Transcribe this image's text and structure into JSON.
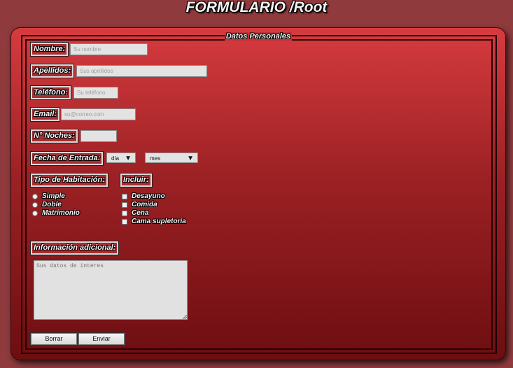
{
  "page": {
    "title": "FORMULARIO /Root"
  },
  "fieldset": {
    "legend": "Datos Personales"
  },
  "fields": {
    "nombre": {
      "label": "Nombre:",
      "placeholder": "Su nombre"
    },
    "apellidos": {
      "label": "Apellidos:",
      "placeholder": "Sus apellidos"
    },
    "telefono": {
      "label": "Teléfono:",
      "placeholder": "Su teléfono"
    },
    "email": {
      "label": "Email:",
      "placeholder": "su@correo.com"
    },
    "noches": {
      "label": "N° Noches:",
      "placeholder": ""
    },
    "fecha": {
      "label": "Fecha de Entrada:",
      "dia": "día",
      "mes": "mes"
    }
  },
  "habitacion": {
    "label": "Tipo de Habitación:",
    "options": [
      "Simple",
      "Doble",
      "Matrimonio"
    ]
  },
  "incluir": {
    "label": "Incluir:",
    "options": [
      "Desayuno",
      "Comida",
      "Cena",
      "Cama supletoria"
    ]
  },
  "info": {
    "label": "Información adicional:",
    "placeholder": "Sus datos de interes"
  },
  "buttons": {
    "reset": "Borrar",
    "submit": "Enviar"
  }
}
